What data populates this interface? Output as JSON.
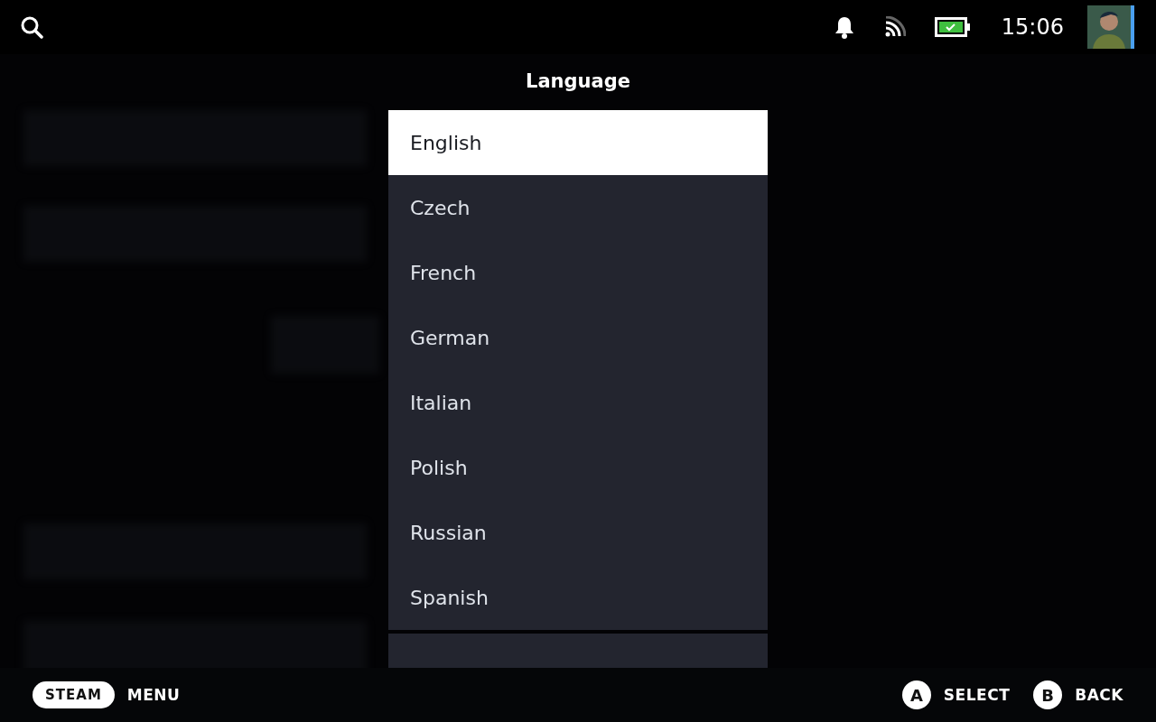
{
  "status_bar": {
    "time": "15:06",
    "battery_charging": true
  },
  "dialog": {
    "title": "Language",
    "options": [
      {
        "label": "English",
        "selected": true
      },
      {
        "label": "Czech",
        "selected": false
      },
      {
        "label": "French",
        "selected": false
      },
      {
        "label": "German",
        "selected": false
      },
      {
        "label": "Italian",
        "selected": false
      },
      {
        "label": "Polish",
        "selected": false
      },
      {
        "label": "Russian",
        "selected": false
      },
      {
        "label": "Spanish",
        "selected": false
      }
    ]
  },
  "footer": {
    "steam": "STEAM",
    "menu": "MENU",
    "actions": [
      {
        "key": "A",
        "label": "SELECT"
      },
      {
        "key": "B",
        "label": "BACK"
      }
    ]
  }
}
